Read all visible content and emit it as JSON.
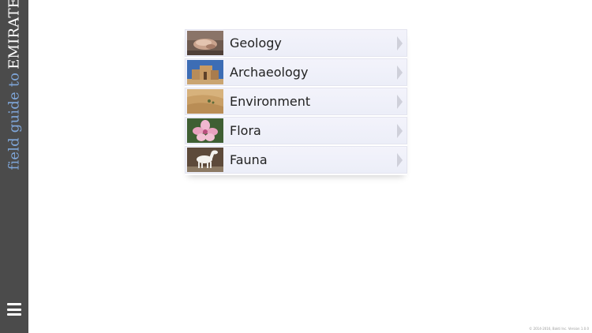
{
  "brand": {
    "part1": "field guide to",
    "part2": "EMIRATES"
  },
  "menu": {
    "icon": "menu-icon"
  },
  "categories": [
    {
      "label": "Geology",
      "image": "geology-photo"
    },
    {
      "label": "Archaeology",
      "image": "archaeology-photo"
    },
    {
      "label": "Environment",
      "image": "environment-photo"
    },
    {
      "label": "Flora",
      "image": "flora-photo"
    },
    {
      "label": "Fauna",
      "image": "fauna-photo"
    }
  ],
  "footer": {
    "text": "© 2014-2016, Bakti Inc. Version 1.0.0"
  },
  "colors": {
    "sidebar": "#4b4b4b",
    "brand_accent": "#7fa6d9",
    "row_bg": "#eceef8"
  }
}
